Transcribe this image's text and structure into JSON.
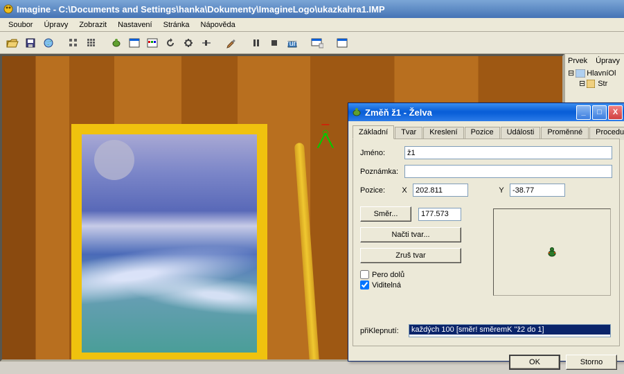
{
  "app": {
    "title": "Imagine  -  C:\\Documents and Settings\\hanka\\Dokumenty\\ImagineLogo\\ukazkahra1.IMP"
  },
  "menu": {
    "soubor": "Soubor",
    "upravy": "Úpravy",
    "zobrazit": "Zobrazit",
    "nastaveni": "Nastavení",
    "stranka": "Stránka",
    "napoveda": "Nápověda"
  },
  "side": {
    "prvek": "Prvek",
    "upravy": "Úpravy",
    "root": "HlavníOl",
    "child": "Str"
  },
  "dialog": {
    "title": "Změň ž1  - Želva",
    "tabs": {
      "zakladni": "Základní",
      "tvar": "Tvar",
      "kresleni": "Kreslení",
      "pozice": "Pozice",
      "udalosti": "Události",
      "promenne": "Proměnné",
      "procedury": "Procedury"
    },
    "labels": {
      "jmeno": "Jméno:",
      "poznamka": "Poznámka:",
      "pozice": "Pozice:",
      "x": "X",
      "y": "Y",
      "priklepnuti": "přiKlepnutí:"
    },
    "values": {
      "jmeno": "ž1",
      "poznamka": "",
      "x": "202.811",
      "y": "-38.77",
      "smer_val": "177.573",
      "priklepnuti": "každých 100 [směr! směremK \"ž2 do 1]"
    },
    "buttons": {
      "smer": "Směr...",
      "nacti": "Načti tvar...",
      "zrus": "Zruš tvar",
      "ok": "OK",
      "storno": "Storno"
    },
    "checks": {
      "pero": "Pero dolů",
      "viditelna": "Viditelná"
    }
  }
}
